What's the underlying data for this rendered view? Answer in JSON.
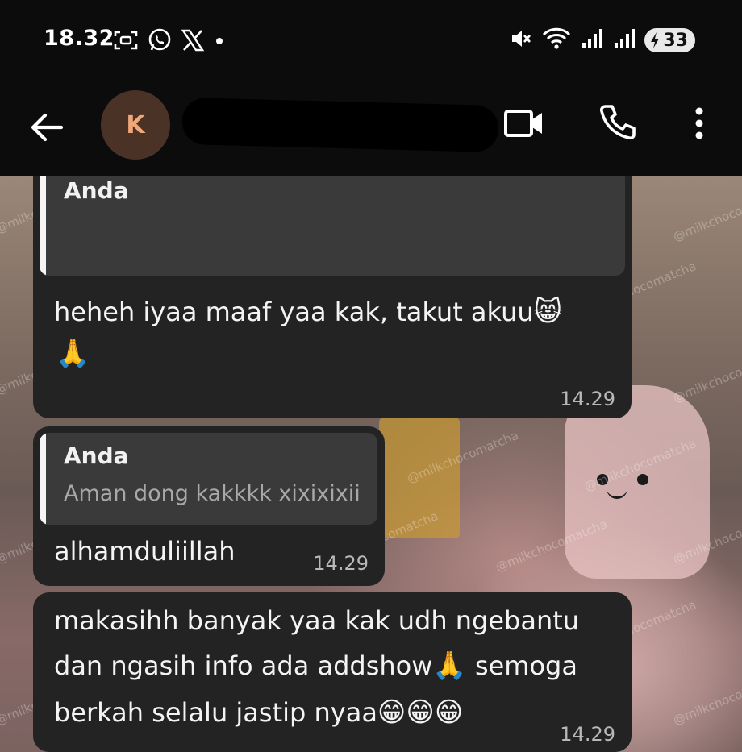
{
  "status_bar": {
    "time": "18.32",
    "battery_level": "33",
    "left_icons": [
      "screenshot-icon",
      "whatsapp-icon",
      "x-icon",
      "dot-icon"
    ],
    "right_icons": [
      "mute-icon",
      "wifi-icon",
      "signal-icon",
      "signal-icon",
      "battery-icon"
    ]
  },
  "header": {
    "avatar_initial": "K",
    "contact_name": "",
    "actions": [
      "back-arrow-icon",
      "video-call-icon",
      "phone-icon",
      "more-vert-icon"
    ]
  },
  "watermark": "@milkchocomatcha",
  "messages": [
    {
      "quote_author": "Anda",
      "quote_text": "",
      "text": "heheh iyaa maaf yaa kak, takut akuu",
      "emoji": [
        "😸",
        "🙏"
      ],
      "time": "14.29"
    },
    {
      "quote_author": "Anda",
      "quote_text": "Aman dong kakkkk xixixixii",
      "text": "alhamduliillah",
      "emoji": [],
      "time": "14.29"
    },
    {
      "text_lines": [
        "makasihh banyak yaa kak udh ngebantu",
        "dan ngasih info ada addshow",
        "semoga",
        "berkah selalu jastip nyaa"
      ],
      "emoji": [
        "🙏",
        "😁",
        "😁",
        "😁"
      ],
      "time": "14.29"
    }
  ]
}
